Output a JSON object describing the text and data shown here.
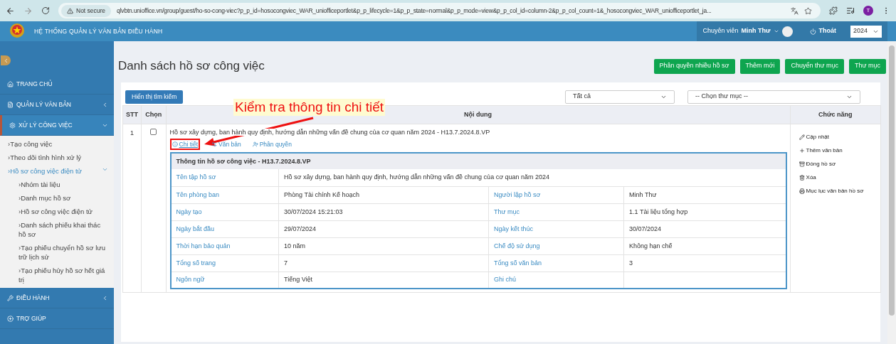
{
  "browser": {
    "security": "Not secure",
    "url": "qlvbtn.unioffice.vn/group/guest/ho-so-cong-viec?p_p_id=hosocongviec_WAR_uniofficeportlet&p_p_lifecycle=1&p_p_state=normal&p_p_mode=view&p_p_col_id=column-2&p_p_col_count=1&_hosocongviec_WAR_uniofficeportlet_ja...",
    "profile": "T"
  },
  "header": {
    "title": "HỆ THỐNG QUẢN LÝ VĂN BẢN ĐIỀU HÀNH",
    "role": "Chuyên viên",
    "user": "Minh Thư",
    "logout": "Thoát",
    "year": "2024"
  },
  "sidebar": {
    "items": [
      {
        "label": "TRANG CHỦ",
        "selected": false
      },
      {
        "label": "QUẢN LÝ VĂN BẢN",
        "selected": false,
        "expanded": false
      },
      {
        "label": "XỬ LÝ CÔNG VIỆC",
        "selected": true,
        "expanded": true,
        "children": [
          {
            "label": "›Tạo công việc",
            "selected": false
          },
          {
            "label": "›Theo dõi tình hình xử lý",
            "selected": false
          },
          {
            "label": "›Hồ sơ công việc điện tử",
            "selected": true,
            "expanded": true,
            "children": [
              {
                "label": "›Nhóm tài liệu",
                "selected": false
              },
              {
                "label": "›Danh mục hồ sơ",
                "selected": false
              },
              {
                "label": "›Hồ sơ công việc điện tử",
                "selected": false
              },
              {
                "label": "›Danh sách phiếu khai thác hồ sơ",
                "selected": false
              },
              {
                "label": "›Tạo phiếu chuyển hồ sơ lưu trữ lịch sử",
                "selected": false
              },
              {
                "label": "›Tạo phiếu hủy hồ sơ hết giá trị",
                "selected": false
              }
            ]
          }
        ]
      },
      {
        "label": "ĐIỀU HÀNH",
        "selected": false,
        "expanded": false
      },
      {
        "label": "TRỢ GIÚP",
        "selected": false
      }
    ]
  },
  "page_title": "Danh sách hồ sơ công việc",
  "actions": [
    "Phân quyền nhiều hồ sơ",
    "Thêm mới",
    "Chuyển thư mục",
    "Thư mục"
  ],
  "search_button": "Hiển thị tìm kiếm",
  "filters": [
    {
      "value": "Tất cả"
    },
    {
      "value": "-- Chọn thư mục --"
    }
  ],
  "annotation": "Kiểm tra thông tin chi tiết",
  "table": {
    "columns": [
      "STT",
      "Chọn",
      "Nội dung",
      "Chức năng"
    ],
    "rows": [
      {
        "stt": "1",
        "checked": false,
        "title": "Hồ sơ xây dựng, ban hành quy định, hướng dẫn những vấn đề chung của cơ quan năm 2024 - H13.7.2024.8.VP",
        "links": [
          {
            "label": "Chi tiết",
            "highlighted": true
          },
          {
            "label": "Văn bản",
            "highlighted": false
          },
          {
            "label": "Phân quyền",
            "highlighted": false
          }
        ],
        "detail": {
          "title": "Thông tin hồ sơ công việc - H13.7.2024.8.VP",
          "wide": {
            "label": "Tên tập hồ sơ",
            "value": "Hồ sơ xây dựng, ban hành quy định, hướng dẫn những vấn đề chung của cơ quan năm 2024"
          },
          "pairs": [
            [
              {
                "label": "Tên phòng ban",
                "value": "Phòng Tài chính Kế hoạch"
              },
              {
                "label": "Người lập hồ sơ",
                "value": "Minh Thư"
              }
            ],
            [
              {
                "label": "Ngày tạo",
                "value": "30/07/2024 15:21:03"
              },
              {
                "label": "Thư mục",
                "value": "1.1 Tài liệu tổng hợp"
              }
            ],
            [
              {
                "label": "Ngày bắt đầu",
                "value": "29/07/2024"
              },
              {
                "label": "Ngày kết thúc",
                "value": "30/07/2024"
              }
            ],
            [
              {
                "label": "Thời hạn bảo quản",
                "value": "10 năm"
              },
              {
                "label": "Chế độ sử dụng",
                "value": "Không hạn chế"
              }
            ],
            [
              {
                "label": "Tổng số trang",
                "value": "7"
              },
              {
                "label": "Tổng số văn bản",
                "value": "3"
              }
            ],
            [
              {
                "label": "Ngôn ngữ",
                "value": "Tiếng Việt"
              },
              {
                "label": "Ghi chú"
              }
            ]
          ]
        },
        "functions": [
          {
            "label": "Cập nhật"
          },
          {
            "label": "Thêm văn bản"
          },
          {
            "label": "Đóng hồ sơ"
          },
          {
            "label": "Xóa"
          },
          {
            "label": "Mục lục văn bản hồ sơ"
          }
        ]
      }
    ]
  }
}
